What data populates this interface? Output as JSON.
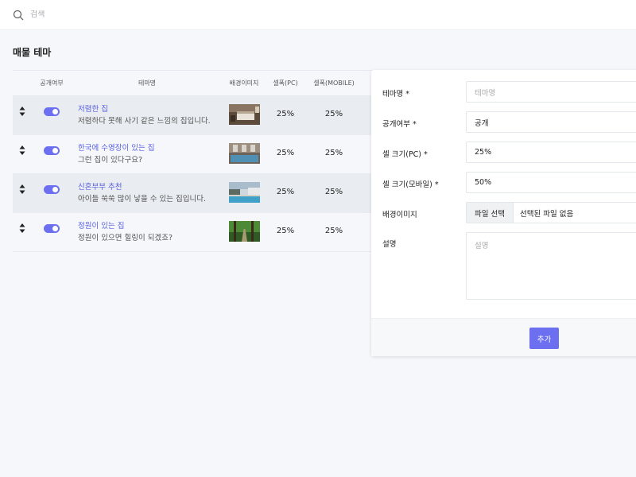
{
  "search": {
    "placeholder": "검색"
  },
  "page": {
    "title": "매물 테마"
  },
  "table": {
    "headers": {
      "public": "공개여부",
      "name": "테마명",
      "image": "배경이미지",
      "pc": "셀폭(PC)",
      "mobile": "셀폭(MOBILE)"
    },
    "rows": [
      {
        "title": "저렴한 집",
        "desc": "저렴하다 못해 사기 같은 느낌의 집입니다.",
        "pc": "25%",
        "mobile": "25%",
        "published": true,
        "image": "hotel-room"
      },
      {
        "title": "한국에 수영장이 있는 집",
        "desc": "그런 집이 있다구요?",
        "pc": "25%",
        "mobile": "25%",
        "published": true,
        "image": "indoor-pool"
      },
      {
        "title": "신혼부부 추천",
        "desc": "아이들 쑥쑥 많이 낳을 수 있는 집입니다.",
        "pc": "25%",
        "mobile": "25%",
        "published": true,
        "image": "outdoor-pool"
      },
      {
        "title": "정원이 있는 집",
        "desc": "정원이 있으면 힐링이 되겠죠?",
        "pc": "25%",
        "mobile": "25%",
        "published": true,
        "image": "forest-path"
      }
    ]
  },
  "form": {
    "name_label": "테마명 *",
    "name_placeholder": "테마명",
    "public_label": "공개여부 *",
    "public_value": "공개",
    "pc_label": "셀 크기(PC) *",
    "pc_value": "25%",
    "mobile_label": "셀 크기(모바일) *",
    "mobile_value": "50%",
    "image_label": "배경이미지",
    "file_button": "파일 선택",
    "file_status": "선택된 파일 없음",
    "desc_label": "설명",
    "desc_placeholder": "설명",
    "submit": "추가"
  },
  "colors": {
    "accent": "#6c6ff0",
    "link": "#5a60e0",
    "background": "#f5f7fb"
  }
}
